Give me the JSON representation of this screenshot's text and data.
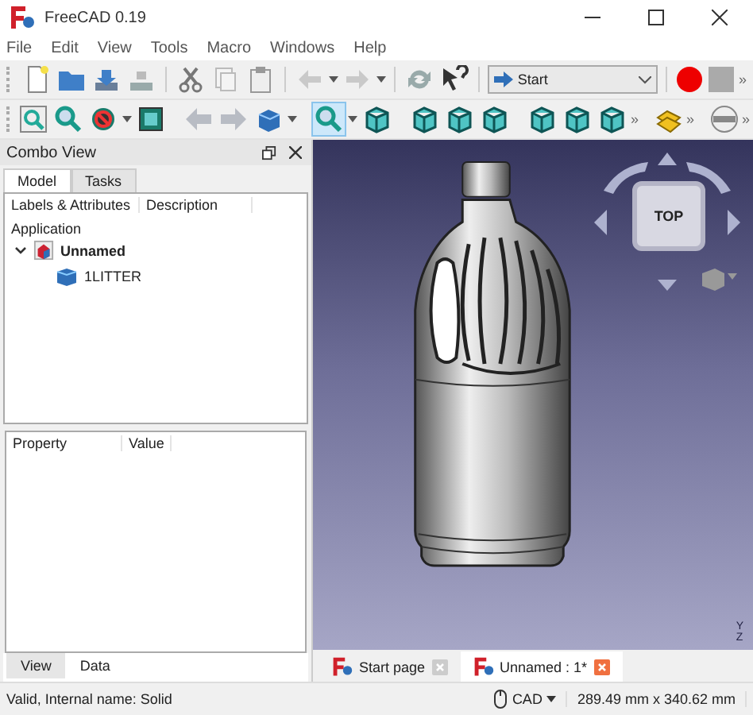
{
  "window": {
    "title": "FreeCAD 0.19"
  },
  "menu": [
    "File",
    "Edit",
    "View",
    "Tools",
    "Macro",
    "Windows",
    "Help"
  ],
  "toolbar": {
    "workbench": "Start",
    "overflow": [
      "»"
    ]
  },
  "toolbar2": {
    "overflow": [
      "»",
      "»",
      "»"
    ]
  },
  "combo_view": {
    "title": "Combo View",
    "tabs": [
      {
        "label": "Model",
        "selected": true
      },
      {
        "label": "Tasks",
        "selected": false
      }
    ],
    "tree": {
      "columns": [
        "Labels & Attributes",
        "Description"
      ],
      "group": "Application",
      "items": [
        {
          "label": "Unnamed",
          "expanded": true,
          "children": [
            {
              "label": "1LITTER"
            }
          ]
        }
      ]
    },
    "property_view": {
      "columns": [
        "Property",
        "Value"
      ],
      "tabs": [
        {
          "label": "View",
          "selected": false
        },
        {
          "label": "Data",
          "selected": true
        }
      ]
    }
  },
  "viewport": {
    "nav_cube_face": "TOP",
    "axis_labels": [
      "Y",
      "Z"
    ]
  },
  "document_tabs": [
    {
      "label": "Start page",
      "selected": false
    },
    {
      "label": "Unnamed : 1*",
      "selected": true
    }
  ],
  "status_bar": {
    "message": "Valid, Internal name: Solid",
    "navigation_style": "CAD",
    "dimensions": "289.49 mm x 340.62 mm"
  }
}
